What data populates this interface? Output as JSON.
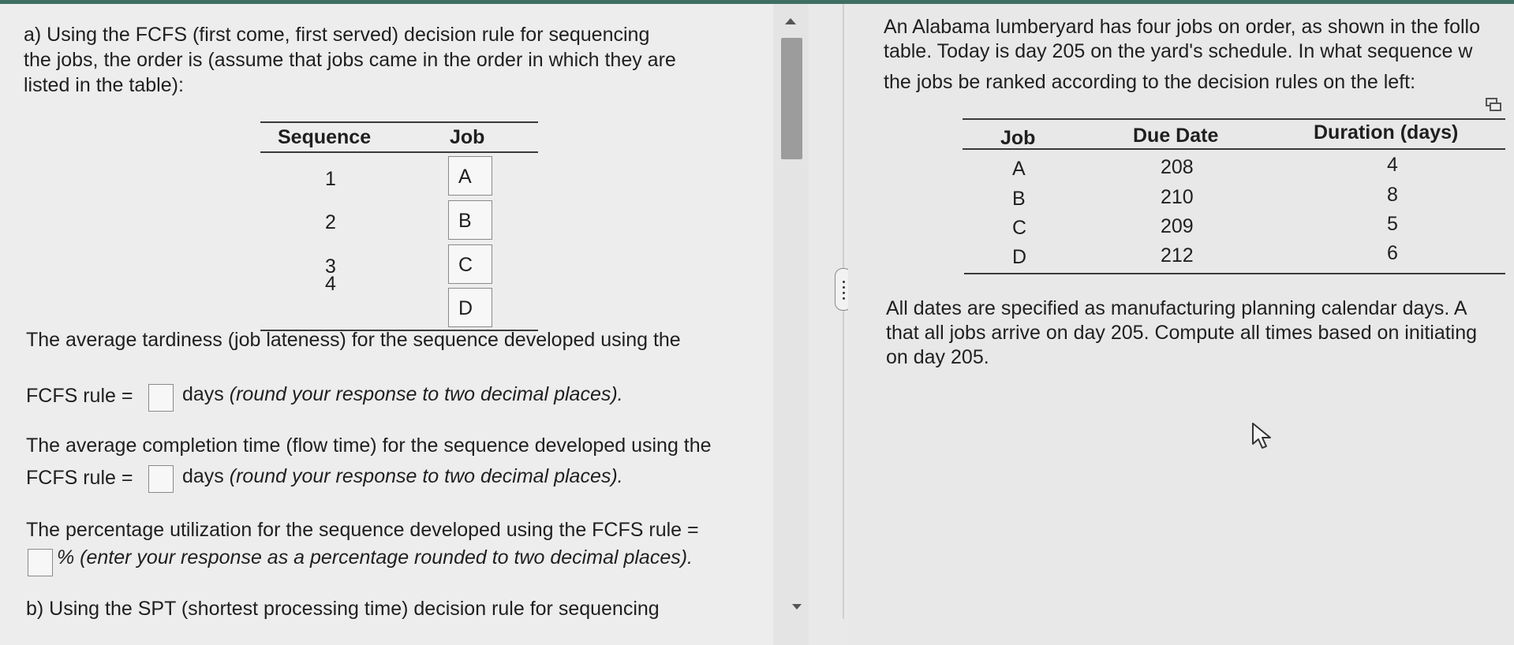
{
  "left": {
    "intro": [
      "a) Using the FCFS (first come, first served) decision rule for sequencing",
      "the jobs, the order is (assume that jobs came in the order in which they are",
      "listed in the table):"
    ],
    "seq_table": {
      "headers": [
        "Sequence",
        "Job"
      ],
      "rows": [
        {
          "seq": "1",
          "job": "A"
        },
        {
          "seq": "2",
          "job": "B"
        },
        {
          "seq": "3",
          "job": "C"
        },
        {
          "seq": "4",
          "job": "D"
        }
      ]
    },
    "q1": {
      "line1": "The average tardiness (job lateness) for the sequence developed using the",
      "prefix": "FCFS rule =",
      "suffix_plain": "days",
      "suffix_italic": "(round your response to two decimal places)."
    },
    "q2": {
      "line1": "The average completion time (flow time) for the sequence developed using the",
      "prefix": "FCFS rule =",
      "suffix_plain": "days",
      "suffix_italic": "(round your response to two decimal places)."
    },
    "q3": {
      "line1": "The percentage utilization for the sequence developed using the FCFS rule =",
      "suffix_italic": "% (enter your response as a percentage rounded to two decimal places)."
    },
    "part_b": "b) Using the SPT (shortest processing time) decision rule for sequencing"
  },
  "right": {
    "intro": [
      "An Alabama lumberyard has four jobs on order, as shown in the follo",
      "table. Today is day 205 on the yard's schedule. In what sequence w",
      "the jobs be ranked according to the decision rules on the left:"
    ],
    "table": {
      "headers": [
        "Job",
        "Due Date",
        "Duration (days)"
      ],
      "rows": [
        [
          "A",
          "208",
          "4"
        ],
        [
          "B",
          "210",
          "8"
        ],
        [
          "C",
          "209",
          "5"
        ],
        [
          "D",
          "212",
          "6"
        ]
      ]
    },
    "note": [
      "All dates are specified as manufacturing planning calendar days. A",
      "that all jobs arrive on day 205. Compute all times based on initiating",
      "on day 205."
    ]
  },
  "icons": {
    "copy": "copy-icon",
    "cursor": "mouse-pointer-icon",
    "scroll_up": "scroll-up-arrow-icon",
    "scroll_down": "scroll-down-arrow-icon",
    "pane_handle": "pane-resize-handle-icon"
  },
  "colors": {
    "top_bar": "#3f6f62",
    "background": "#ededed"
  }
}
